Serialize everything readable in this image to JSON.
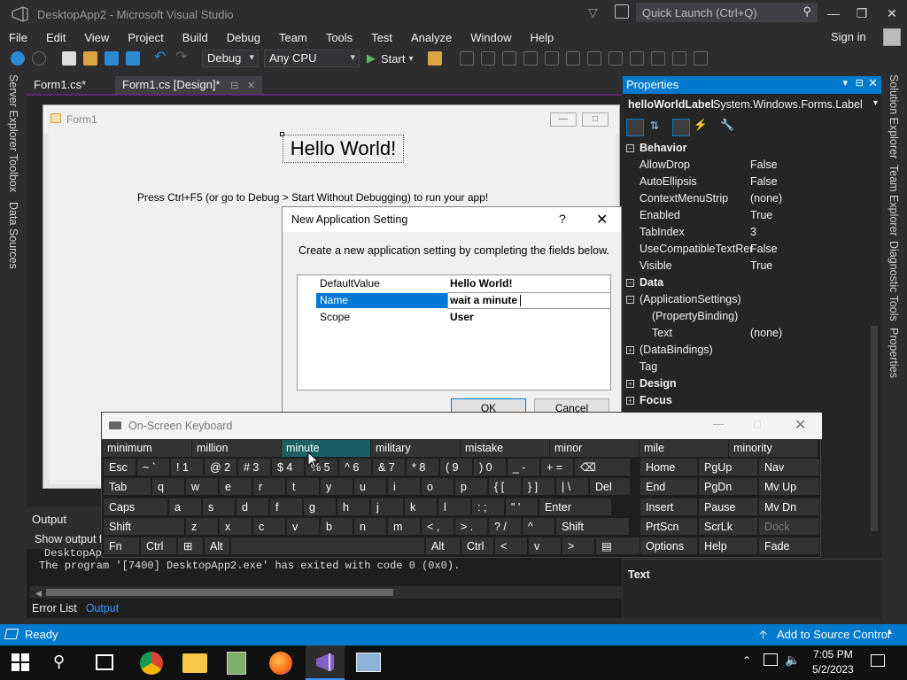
{
  "window": {
    "title": "DesktopApp2 - Microsoft Visual Studio",
    "quick_launch_placeholder": "Quick Launch (Ctrl+Q)"
  },
  "menu": [
    "File",
    "Edit",
    "View",
    "Project",
    "Build",
    "Debug",
    "Team",
    "Tools",
    "Test",
    "Analyze",
    "Window",
    "Help"
  ],
  "sign_in": "Sign in",
  "toolbar": {
    "config": "Debug",
    "platform": "Any CPU",
    "start": "Start"
  },
  "left_strip": [
    "Server Explorer",
    "Toolbox",
    "Data Sources"
  ],
  "right_strip": [
    "Solution Explorer",
    "Team Explorer",
    "Diagnostic Tools",
    "Properties"
  ],
  "tabs": [
    {
      "label": "Form1.cs*"
    },
    {
      "label": "Form1.cs [Design]*"
    }
  ],
  "form": {
    "caption": "Form1",
    "hello": "Hello World!",
    "instruction": "Press Ctrl+F5 (or go to Debug > Start Without Debugging) to run your app!"
  },
  "dialog": {
    "title": "New Application Setting",
    "help": "?",
    "description": "Create a new application setting by completing the fields below.",
    "rows": [
      {
        "name": "DefaultValue",
        "value": "Hello World!"
      },
      {
        "name": "Name",
        "value": "wait a minute "
      },
      {
        "name": "Scope",
        "value": "User"
      }
    ],
    "ok": "OK",
    "cancel": "Cancel"
  },
  "properties": {
    "header": "Properties",
    "object_name": "helloWorldLabel",
    "object_type": "System.Windows.Forms.Label",
    "rows": [
      {
        "name": "Behavior",
        "category": true,
        "exp": "⊟"
      },
      {
        "name": "AllowDrop",
        "value": "False"
      },
      {
        "name": "AutoEllipsis",
        "value": "False"
      },
      {
        "name": "ContextMenuStrip",
        "value": "(none)"
      },
      {
        "name": "Enabled",
        "value": "True"
      },
      {
        "name": "TabIndex",
        "value": "3"
      },
      {
        "name": "UseCompatibleTextRer",
        "value": "False"
      },
      {
        "name": "Visible",
        "value": "True"
      },
      {
        "name": "Data",
        "category": true,
        "exp": "⊟"
      },
      {
        "name": "(ApplicationSettings)",
        "value": "",
        "exp": "⊟"
      },
      {
        "name": "(PropertyBinding)",
        "value": "",
        "indent": true
      },
      {
        "name": "Text",
        "value": "(none)",
        "indent": true
      },
      {
        "name": "(DataBindings)",
        "value": "",
        "exp": "⊞"
      },
      {
        "name": "Tag",
        "value": ""
      },
      {
        "name": "Design",
        "category": true,
        "exp": "⊞"
      },
      {
        "name": "Focus",
        "category": true,
        "exp": "⊞"
      }
    ],
    "description_title": "Text"
  },
  "output": {
    "title": "Output",
    "show_from": "Show output f",
    "lines": [
      "DesktopAp",
      "The program '[7400] DesktopApp2.exe' has exited with code 0 (0x0)."
    ]
  },
  "bottom_tabs": [
    "Error List",
    "Output"
  ],
  "status": {
    "left": "Ready",
    "right": "Add to Source Control"
  },
  "osk": {
    "title": "On-Screen Keyboard",
    "predictions": [
      "minimum",
      "million",
      "minute",
      "military",
      "mistake",
      "minor",
      "mile",
      "minority"
    ],
    "row1": [
      {
        "t": "Esc"
      },
      {
        "t": "~ `"
      },
      {
        "t": "! 1"
      },
      {
        "t": "@ 2"
      },
      {
        "t": "# 3"
      },
      {
        "t": "$ 4"
      },
      {
        "t": "% 5"
      },
      {
        "t": "^ 6"
      },
      {
        "t": "& 7"
      },
      {
        "t": "* 8"
      },
      {
        "t": "( 9"
      },
      {
        "t": ") 0"
      },
      {
        "t": "_ -"
      },
      {
        "t": "+ ="
      },
      {
        "t": "⌫"
      }
    ],
    "row2": [
      "Tab",
      "q",
      "w",
      "e",
      "r",
      "t",
      "y",
      "u",
      "i",
      "o",
      "p",
      "{ [",
      "} ]",
      "| \\",
      "Del"
    ],
    "row3": [
      "Caps",
      "a",
      "s",
      "d",
      "f",
      "g",
      "h",
      "j",
      "k",
      "l",
      ": ;",
      "\" '",
      "Enter"
    ],
    "row4": [
      "Shift",
      "z",
      "x",
      "c",
      "v",
      "b",
      "n",
      "m",
      "< ,",
      "> .",
      "? /",
      "^",
      "Shift"
    ],
    "row5": [
      "Fn",
      "Ctrl",
      "⊞",
      "Alt",
      "",
      "Alt",
      "Ctrl",
      "<",
      "v",
      ">",
      "▤"
    ],
    "side": [
      [
        "Home",
        "PgUp",
        "Nav"
      ],
      [
        "End",
        "PgDn",
        "Mv Up"
      ],
      [
        "Insert",
        "Pause",
        "Mv Dn"
      ],
      [
        "PrtScn",
        "ScrLk",
        "Dock"
      ],
      [
        "Options",
        "Help",
        "Fade"
      ]
    ]
  },
  "clock": {
    "time": "7:05 PM",
    "date": "5/2/2023"
  },
  "colors": {
    "accent": "#007acc",
    "selection": "#0078d7",
    "vs_purple": "#68217a"
  }
}
